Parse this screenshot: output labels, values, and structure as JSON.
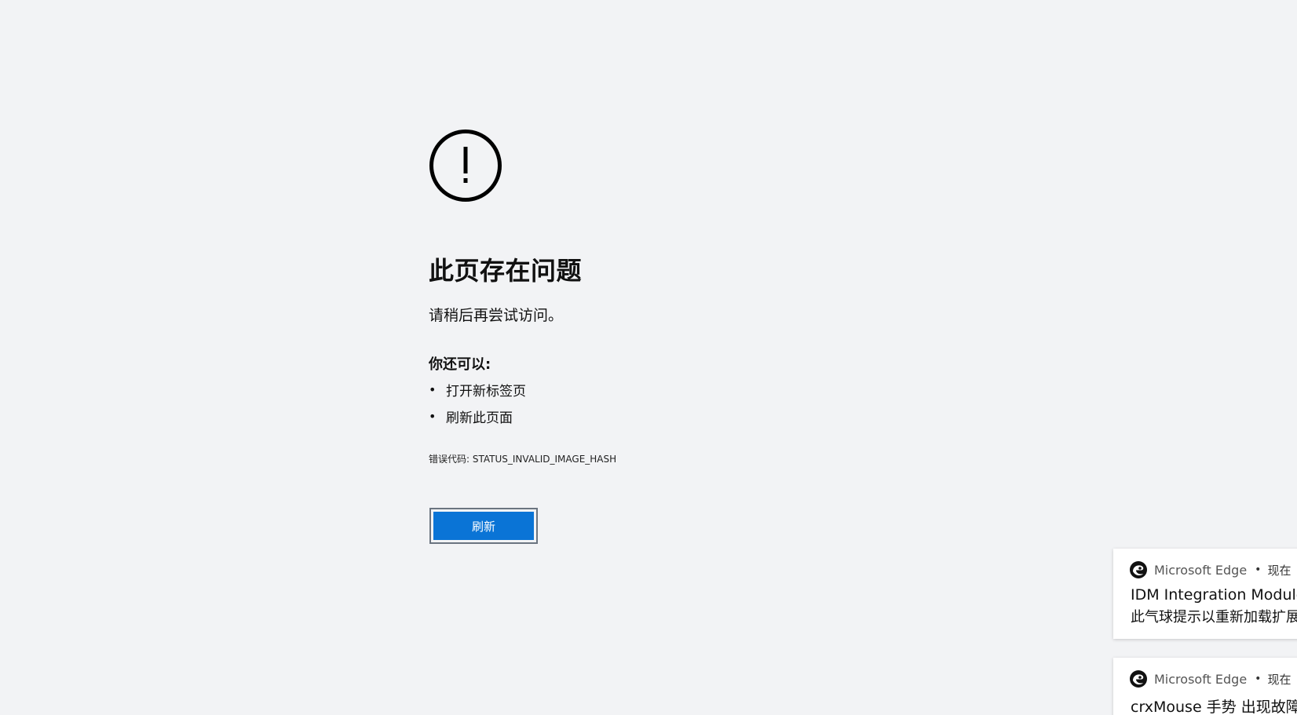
{
  "error_page": {
    "title": "此页存在问题",
    "subtitle": "请稍后再尝试访问。",
    "suggest_heading": "你还可以:",
    "suggestions": [
      "打开新标签页",
      "刷新此页面"
    ],
    "bullet": "•",
    "error_code": "错误代码: STATUS_INVALID_IMAGE_HASH",
    "refresh_button": "刷新",
    "accent_color": "#0a74d6"
  },
  "notifications": [
    {
      "app": "Microsoft Edge",
      "separator": "•",
      "time": "现在",
      "title": "IDM Integration Module",
      "body": "此气球提示以重新加载扩展"
    },
    {
      "app": "Microsoft Edge",
      "separator": "•",
      "time": "现在",
      "title": "crxMouse 手势 出现故障"
    }
  ],
  "icons": {
    "error": "exclamation-circle-icon",
    "notification_app": "edge-icon"
  }
}
